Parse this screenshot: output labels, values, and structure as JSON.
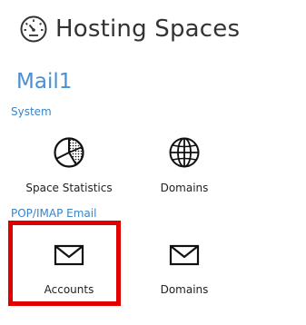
{
  "header": {
    "title": "Hosting Spaces",
    "icon": "gauge-icon"
  },
  "space": {
    "name": "Mail1"
  },
  "groups": [
    {
      "label": "System",
      "items": [
        {
          "label": "Space Statistics",
          "icon": "pie-chart-icon"
        },
        {
          "label": "Domains",
          "icon": "globe-icon"
        }
      ]
    },
    {
      "label": "POP/IMAP Email",
      "items": [
        {
          "label": "Accounts",
          "icon": "envelope-icon",
          "highlighted": true
        },
        {
          "label": "Domains",
          "icon": "envelope-icon"
        }
      ]
    }
  ],
  "colors": {
    "accent": "#4a8fd1",
    "group_label": "#3a84c8",
    "highlight": "#e00000",
    "text": "#222222"
  }
}
